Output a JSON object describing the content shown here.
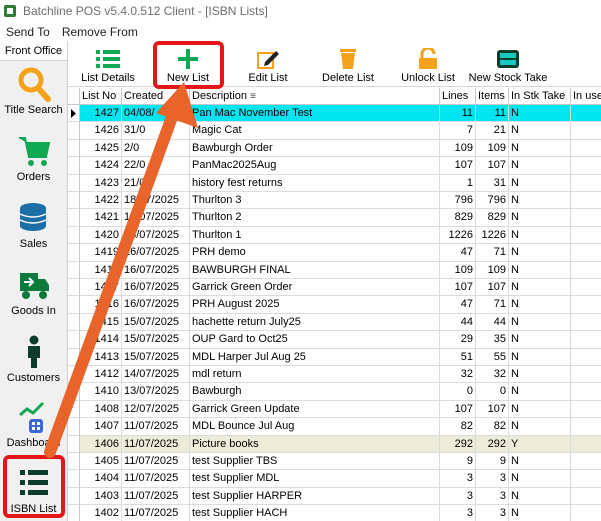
{
  "window": {
    "title": "Batchline POS v5.4.0.512 Client - [ISBN Lists]"
  },
  "menu": [
    "Send To",
    "Remove From"
  ],
  "sidebar": {
    "header": "Front Office",
    "items": [
      {
        "label": "Title Search",
        "icon": "magnifier-icon"
      },
      {
        "label": "Orders",
        "icon": "cart-icon"
      },
      {
        "label": "Sales",
        "icon": "coins-icon"
      },
      {
        "label": "Goods In",
        "icon": "delivery-truck-icon"
      },
      {
        "label": "Customers",
        "icon": "person-icon"
      },
      {
        "label": "Dashboard",
        "icon": "dashboard-chart-icon"
      },
      {
        "label": "ISBN List",
        "icon": "list-icon"
      }
    ]
  },
  "toolbar": [
    {
      "label": "List Details",
      "icon": "list-details-icon"
    },
    {
      "label": "New List",
      "icon": "plus-icon"
    },
    {
      "label": "Edit List",
      "icon": "pencil-icon"
    },
    {
      "label": "Delete List",
      "icon": "trash-icon"
    },
    {
      "label": "Unlock List",
      "icon": "padlock-icon"
    },
    {
      "label": "New Stock Take",
      "icon": "stock-box-icon"
    }
  ],
  "grid": {
    "columns": [
      "List No",
      "Created",
      "Description",
      "Lines",
      "Items",
      "In Stk Take",
      "In use"
    ],
    "rows": [
      {
        "no": "1427",
        "created": "04/08/",
        "desc": "Pan Mac November Test",
        "lines": "11",
        "items": "11",
        "stk": "N",
        "selected": true
      },
      {
        "no": "1426",
        "created": "31/0",
        "desc": "Magic Cat",
        "lines": "7",
        "items": "21",
        "stk": "N"
      },
      {
        "no": "1425",
        "created": "2/0",
        "desc": "Bawburgh Order",
        "lines": "109",
        "items": "109",
        "stk": "N"
      },
      {
        "no": "1424",
        "created": "22/0",
        "desc": "PanMac2025Aug",
        "lines": "107",
        "items": "107",
        "stk": "N"
      },
      {
        "no": "1423",
        "created": "21/0",
        "desc": "history fest returns",
        "lines": "1",
        "items": "31",
        "stk": "N"
      },
      {
        "no": "1422",
        "created": "18/07/2025",
        "desc": "Thurlton 3",
        "lines": "796",
        "items": "796",
        "stk": "N"
      },
      {
        "no": "1421",
        "created": "17/07/2025",
        "desc": "Thurlton 2",
        "lines": "829",
        "items": "829",
        "stk": "N"
      },
      {
        "no": "1420",
        "created": "16/07/2025",
        "desc": "Thurlton 1",
        "lines": "1226",
        "items": "1226",
        "stk": "N"
      },
      {
        "no": "1419",
        "created": "16/07/2025",
        "desc": "PRH demo",
        "lines": "47",
        "items": "71",
        "stk": "N"
      },
      {
        "no": "1418",
        "created": "16/07/2025",
        "desc": "BAWBURGH FINAL",
        "lines": "109",
        "items": "109",
        "stk": "N"
      },
      {
        "no": "1417",
        "created": "16/07/2025",
        "desc": "Garrick Green Order",
        "lines": "107",
        "items": "107",
        "stk": "N"
      },
      {
        "no": "1416",
        "created": "16/07/2025",
        "desc": "PRH August 2025",
        "lines": "47",
        "items": "71",
        "stk": "N"
      },
      {
        "no": "1415",
        "created": "15/07/2025",
        "desc": "hachette return July25",
        "lines": "44",
        "items": "44",
        "stk": "N"
      },
      {
        "no": "1414",
        "created": "15/07/2025",
        "desc": "OUP Gard to Oct25",
        "lines": "29",
        "items": "35",
        "stk": "N"
      },
      {
        "no": "1413",
        "created": "15/07/2025",
        "desc": "MDL Harper Jul Aug 25",
        "lines": "51",
        "items": "55",
        "stk": "N"
      },
      {
        "no": "1412",
        "created": "14/07/2025",
        "desc": "mdl return",
        "lines": "32",
        "items": "32",
        "stk": "N"
      },
      {
        "no": "1410",
        "created": "13/07/2025",
        "desc": "Bawburgh",
        "lines": "0",
        "items": "0",
        "stk": "N"
      },
      {
        "no": "1408",
        "created": "12/07/2025",
        "desc": "Garrick Green Update",
        "lines": "107",
        "items": "107",
        "stk": "N"
      },
      {
        "no": "1407",
        "created": "11/07/2025",
        "desc": "MDL Bounce Jul Aug",
        "lines": "82",
        "items": "82",
        "stk": "N"
      },
      {
        "no": "1406",
        "created": "11/07/2025",
        "desc": "Picture books",
        "lines": "292",
        "items": "292",
        "stk": "Y",
        "alt": true
      },
      {
        "no": "1405",
        "created": "11/07/2025",
        "desc": "test Supplier TBS",
        "lines": "9",
        "items": "9",
        "stk": "N"
      },
      {
        "no": "1404",
        "created": "11/07/2025",
        "desc": "test Supplier MDL",
        "lines": "3",
        "items": "3",
        "stk": "N"
      },
      {
        "no": "1403",
        "created": "11/07/2025",
        "desc": "test Supplier HARPER",
        "lines": "3",
        "items": "3",
        "stk": "N"
      },
      {
        "no": "1402",
        "created": "11/07/2025",
        "desc": "test Supplier HACH",
        "lines": "3",
        "items": "3",
        "stk": "N"
      }
    ]
  },
  "colors": {
    "selected_row": "#00e5ef",
    "highlight_row": "#ececd9",
    "annotation": "#e31717",
    "arrow": "#e8642a"
  }
}
